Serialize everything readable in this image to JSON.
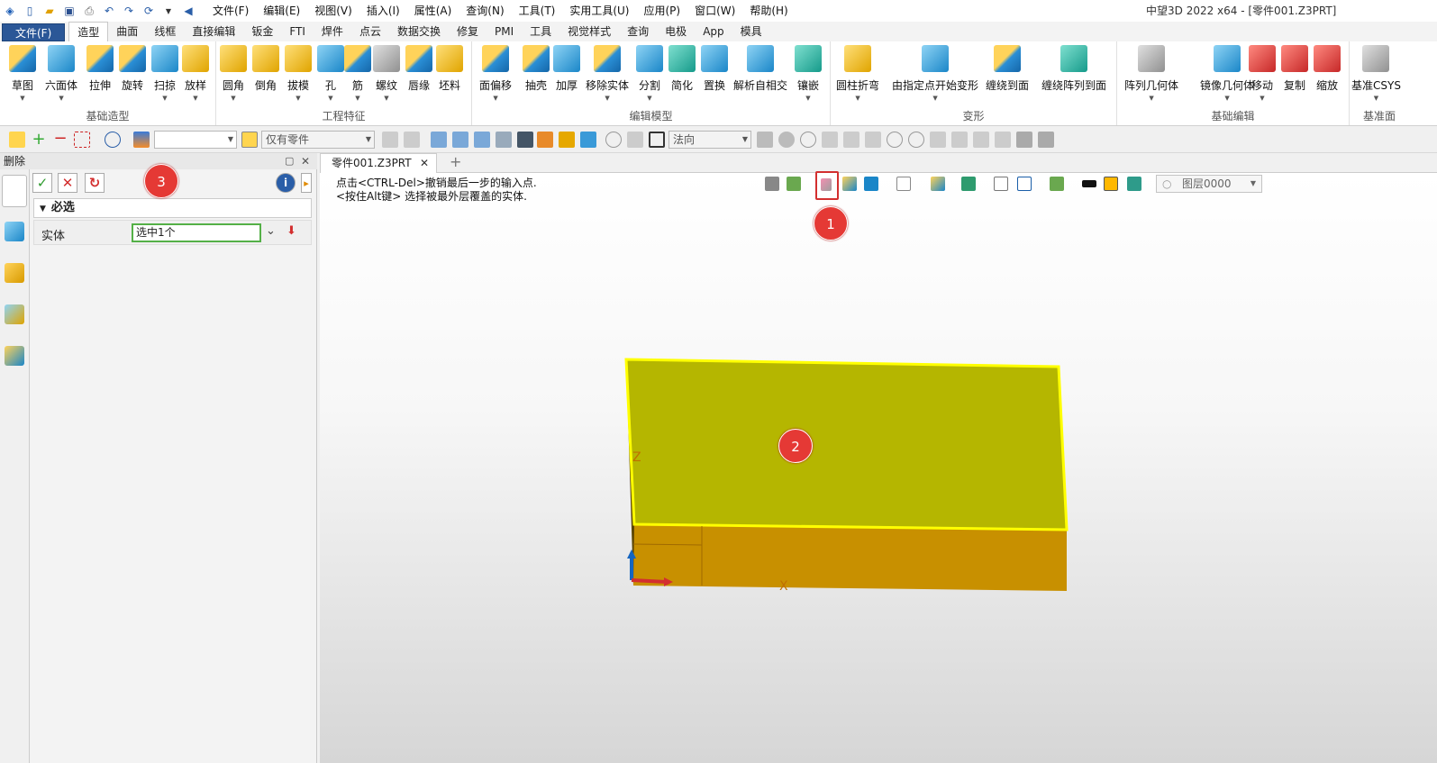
{
  "window_title": "中望3D 2022 x64 - [零件001.Z3PRT]",
  "menu": [
    "文件(F)",
    "编辑(E)",
    "视图(V)",
    "插入(I)",
    "属性(A)",
    "查询(N)",
    "工具(T)",
    "实用工具(U)",
    "应用(P)",
    "窗口(W)",
    "帮助(H)"
  ],
  "tabs": {
    "file": "文件(F)",
    "items": [
      "造型",
      "曲面",
      "线框",
      "直接编辑",
      "钣金",
      "FTI",
      "焊件",
      "点云",
      "数据交换",
      "修复",
      "PMI",
      "工具",
      "视觉样式",
      "查询",
      "电极",
      "App",
      "模具"
    ],
    "active": "造型"
  },
  "ribbon": {
    "groups": [
      {
        "label": "基础造型",
        "buttons": [
          "草图",
          "六面体",
          "拉伸",
          "旋转",
          "扫掠",
          "放样"
        ]
      },
      {
        "label": "工程特征",
        "buttons": [
          "圆角",
          "倒角",
          "拔模",
          "孔",
          "筋",
          "螺纹",
          "唇缘",
          "坯料"
        ]
      },
      {
        "label": "编辑模型",
        "buttons": [
          "面偏移",
          "抽壳",
          "加厚",
          "移除实体",
          "分割",
          "简化",
          "置换",
          "解析自相交",
          "镶嵌"
        ]
      },
      {
        "label": "变形",
        "buttons": [
          "圆柱折弯",
          "由指定点开始变形",
          "缠绕到面",
          "缠绕阵列到面"
        ]
      },
      {
        "label": "基础编辑",
        "buttons": [
          "阵列几何体",
          "镜像几何体",
          "移动",
          "复制",
          "缩放"
        ]
      },
      {
        "label": "基准面",
        "buttons": [
          "基准CSYS"
        ]
      }
    ]
  },
  "toolbar2": {
    "filter_combo": "仅有零件",
    "direction_combo": "法向"
  },
  "panel": {
    "title": "删除",
    "required_label": "必选",
    "field_label": "实体",
    "field_value": "选中1个"
  },
  "document_tab": "零件001.Z3PRT",
  "viewport": {
    "hint_line1": "点击<CTRL-Del>撤销最后一步的输入点.",
    "hint_line2": "<按住Alt键> 选择被最外层覆盖的实体.",
    "layer": "图层0000",
    "axis_z": "Z",
    "axis_x": "X"
  },
  "annotations": [
    "1",
    "2",
    "3"
  ],
  "colors": {
    "brand": "#2b5797",
    "solid_top": "#b5b600",
    "solid_side": "#c89000",
    "selection": "#ffff00",
    "badge": "#e53935"
  }
}
